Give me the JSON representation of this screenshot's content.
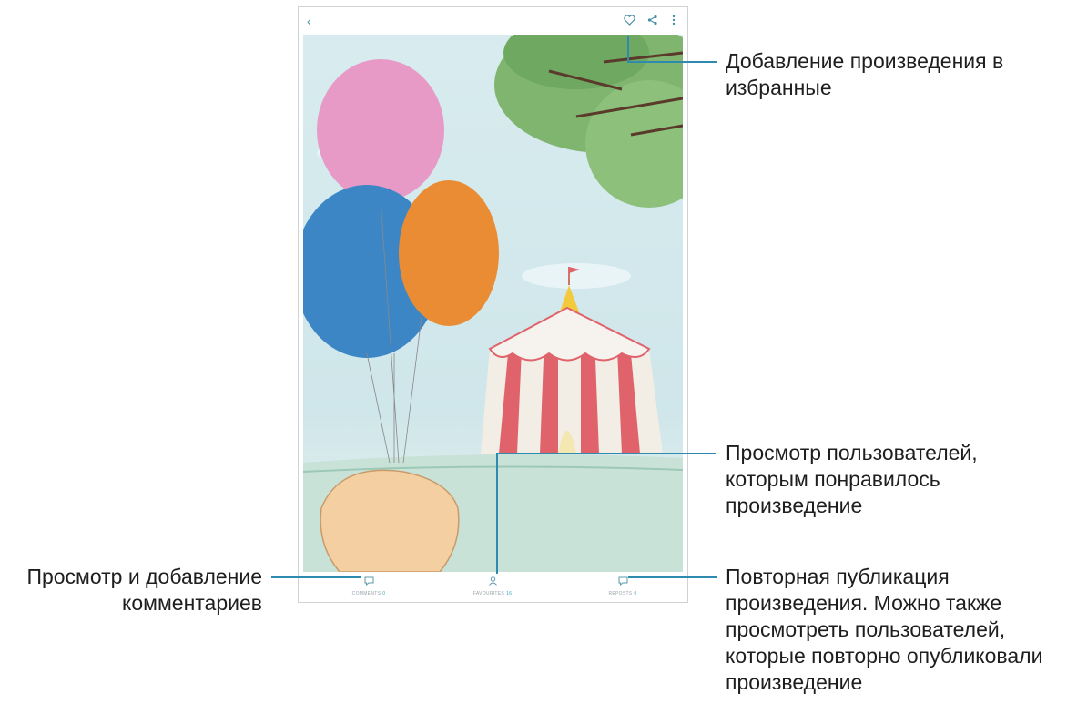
{
  "topbar": {
    "back_icon": "back-arrow-icon",
    "icons": [
      "heart-icon",
      "share-icon",
      "more-icon"
    ]
  },
  "bottombar": {
    "comments": {
      "label": "COMMENTS",
      "count": "0"
    },
    "favourites": {
      "label": "FAVOURITES",
      "count": "16"
    },
    "reposts": {
      "label": "REPOSTS",
      "count": "0"
    }
  },
  "callouts": {
    "favourite": [
      "Добавление произведения в",
      "избранные"
    ],
    "likes": [
      "Просмотр пользователей,",
      "которым понравилось",
      "произведение"
    ],
    "comments": [
      "Просмотр и добавление",
      "комментариев"
    ],
    "repost": [
      "Повторная публикация",
      "произведения. Можно также",
      "просмотреть пользователей,",
      "которые повторно опубликовали",
      "произведение"
    ]
  },
  "colors": {
    "accent": "#2f8ab0"
  }
}
